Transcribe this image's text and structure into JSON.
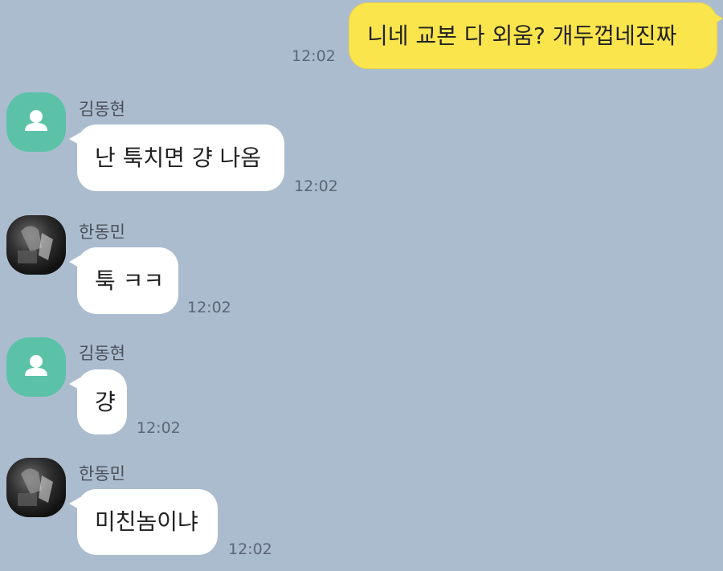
{
  "chat": {
    "messages": [
      {
        "type": "outgoing",
        "text": "니네 교본 다 외움? 개두껍네진짜",
        "time": "12:02"
      },
      {
        "type": "incoming",
        "sender": "김동현",
        "avatar": "default-user-icon",
        "text": "난 툭치면 걍 나옴",
        "time": "12:02"
      },
      {
        "type": "incoming",
        "sender": "한동민",
        "avatar": "photo-avatar",
        "text": "툭 ㅋㅋ",
        "time": "12:02"
      },
      {
        "type": "incoming",
        "sender": "김동현",
        "avatar": "default-user-icon",
        "text": "걍",
        "time": "12:02"
      },
      {
        "type": "incoming",
        "sender": "한동민",
        "avatar": "photo-avatar",
        "text": "미친놈이냐",
        "time": "12:02"
      }
    ]
  },
  "colors": {
    "background": "#abbccf",
    "outgoing_bubble": "#fbe54d",
    "incoming_bubble": "#ffffff",
    "default_avatar": "#5bc2a8"
  }
}
